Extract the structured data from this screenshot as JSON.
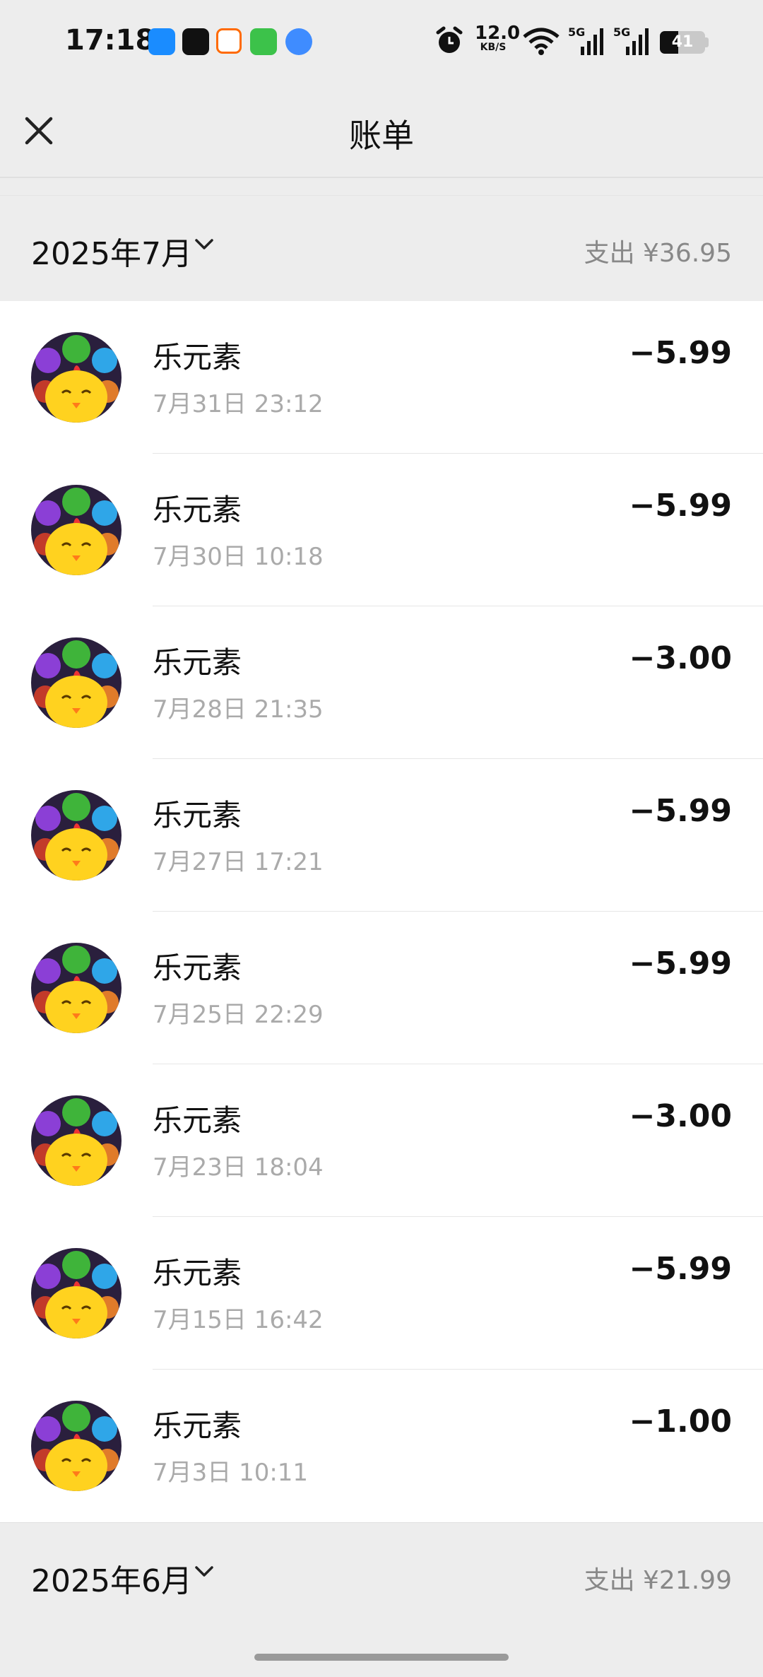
{
  "status_bar": {
    "time": "17:18",
    "net_speed_value": "12.0",
    "net_speed_unit": "KB/S",
    "signal_1": "5G",
    "signal_2": "5G",
    "battery": "41"
  },
  "header": {
    "title": "账单",
    "close_icon": "close-icon"
  },
  "months": [
    {
      "label": "2025年7月",
      "total": "支出 ¥36.95",
      "transactions": [
        {
          "merchant": "乐元素",
          "datetime": "7月31日 23:12",
          "amount": "−5.99"
        },
        {
          "merchant": "乐元素",
          "datetime": "7月30日 10:18",
          "amount": "−5.99"
        },
        {
          "merchant": "乐元素",
          "datetime": "7月28日 21:35",
          "amount": "−3.00"
        },
        {
          "merchant": "乐元素",
          "datetime": "7月27日 17:21",
          "amount": "−5.99"
        },
        {
          "merchant": "乐元素",
          "datetime": "7月25日 22:29",
          "amount": "−5.99"
        },
        {
          "merchant": "乐元素",
          "datetime": "7月23日 18:04",
          "amount": "−3.00"
        },
        {
          "merchant": "乐元素",
          "datetime": "7月15日 16:42",
          "amount": "−5.99"
        },
        {
          "merchant": "乐元素",
          "datetime": "7月3日 10:11",
          "amount": "−1.00"
        }
      ]
    },
    {
      "label": "2025年6月",
      "total": "支出 ¥21.99"
    }
  ]
}
